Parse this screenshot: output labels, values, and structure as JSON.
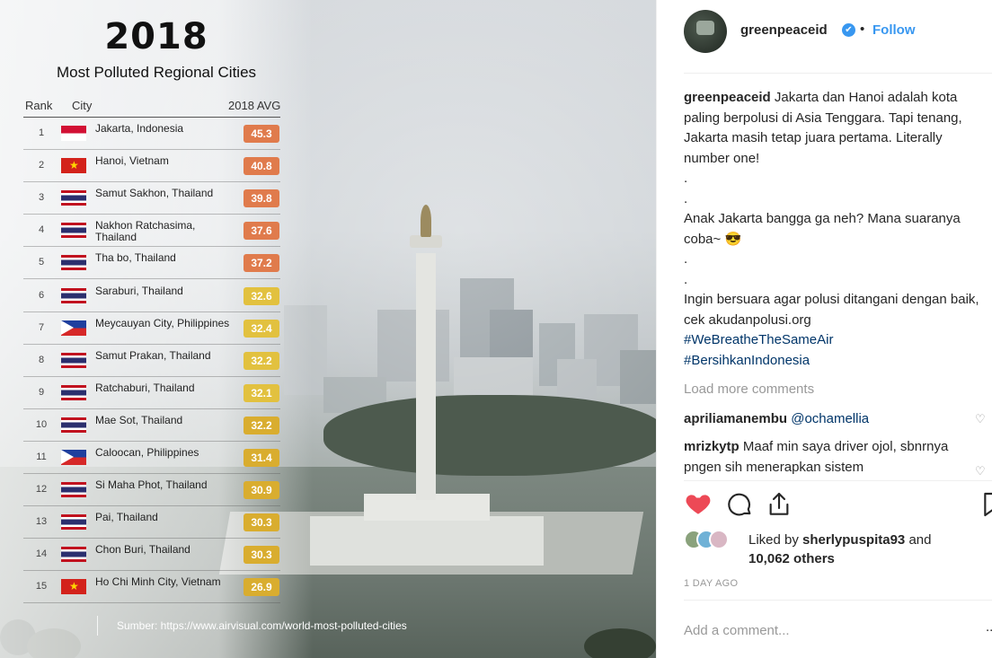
{
  "infographic": {
    "year": "2018",
    "title": "Most Polluted Regional Cities",
    "headers": {
      "rank": "Rank",
      "city": "City",
      "avg": "2018 AVG"
    },
    "rows": [
      {
        "rank": "1",
        "city": "Jakarta, Indonesia",
        "avg": "45.3",
        "flag": "id",
        "color": "#e07b4c"
      },
      {
        "rank": "2",
        "city": "Hanoi, Vietnam",
        "avg": "40.8",
        "flag": "vn",
        "color": "#e07b4c"
      },
      {
        "rank": "3",
        "city": "Samut Sakhon, Thailand",
        "avg": "39.8",
        "flag": "th",
        "color": "#e07b4c"
      },
      {
        "rank": "4",
        "city": "Nakhon Ratchasima, Thailand",
        "avg": "37.6",
        "flag": "th",
        "color": "#e07b4c"
      },
      {
        "rank": "5",
        "city": "Tha bo, Thailand",
        "avg": "37.2",
        "flag": "th",
        "color": "#e07b4c"
      },
      {
        "rank": "6",
        "city": "Saraburi, Thailand",
        "avg": "32.6",
        "flag": "th",
        "color": "#e2c13f"
      },
      {
        "rank": "7",
        "city": "Meycauyan City, Philippines",
        "avg": "32.4",
        "flag": "ph",
        "color": "#e2c13f"
      },
      {
        "rank": "8",
        "city": "Samut Prakan, Thailand",
        "avg": "32.2",
        "flag": "th",
        "color": "#e2c13f"
      },
      {
        "rank": "9",
        "city": "Ratchaburi, Thailand",
        "avg": "32.1",
        "flag": "th",
        "color": "#e2c13f"
      },
      {
        "rank": "10",
        "city": "Mae Sot, Thailand",
        "avg": "32.2",
        "flag": "th",
        "color": "#d9ad2f"
      },
      {
        "rank": "11",
        "city": "Caloocan, Philippines",
        "avg": "31.4",
        "flag": "ph",
        "color": "#d9ad2f"
      },
      {
        "rank": "12",
        "city": "Si Maha Phot, Thailand",
        "avg": "30.9",
        "flag": "th",
        "color": "#d9ad2f"
      },
      {
        "rank": "13",
        "city": "Pai, Thailand",
        "avg": "30.3",
        "flag": "th",
        "color": "#d9ad2f"
      },
      {
        "rank": "14",
        "city": "Chon Buri, Thailand",
        "avg": "30.3",
        "flag": "th",
        "color": "#d9ad2f"
      },
      {
        "rank": "15",
        "city": "Ho Chi Minh City, Vietnam",
        "avg": "26.9",
        "flag": "vn",
        "color": "#d9ad2f"
      }
    ],
    "source": "Sumber: https://www.airvisual.com/world-most-polluted-cities"
  },
  "post": {
    "username": "greenpeaceid",
    "verified_icon": "✔",
    "separator": "•",
    "follow_label": "Follow",
    "caption": {
      "username": "greenpeaceid",
      "paragraphs": [
        "Jakarta dan Hanoi adalah kota paling berpolusi di Asia Tenggara. Tapi tenang, Jakarta masih tetap juara pertama. Literally number one!",
        ".",
        ".",
        "Anak Jakarta bangga ga neh? Mana suaranya coba~ 😎",
        ".",
        ".",
        "Ingin bersuara agar polusi ditangani dengan baik, cek akudanpolusi.org"
      ],
      "hashtags": [
        "#WeBreatheTheSameAir",
        "#BersihkanIndonesia"
      ]
    },
    "load_more": "Load more comments",
    "comments": [
      {
        "user": "apriliamanembu",
        "text": "@ochamellia"
      },
      {
        "user": "mrizkytp",
        "text": "Maaf min saya driver ojol, sbnrnya pngen sih menerapkan sistem"
      }
    ],
    "likes": {
      "prefix": "Liked by",
      "user": "sherlypuspita93",
      "suffix": "and",
      "others": "10,062 others"
    },
    "time_ago": "1 DAY AGO",
    "add_comment_placeholder": "Add a comment...",
    "more_label": "..."
  }
}
